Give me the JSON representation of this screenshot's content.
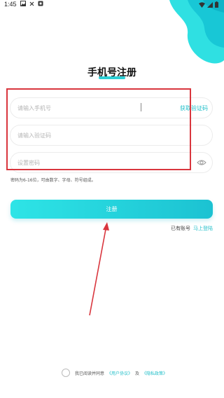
{
  "status_bar": {
    "time": "1:45"
  },
  "page": {
    "title": "手机号注册"
  },
  "form": {
    "phone_placeholder": "请输入手机号",
    "get_code_label": "获取验证码",
    "code_placeholder": "请输入验证码",
    "password_placeholder": "设置密码",
    "password_hint": "密码为6-16位，可由数字、字母、符号组成。",
    "submit_label": "注册"
  },
  "login": {
    "prompt": "已有账号",
    "link_label": "马上登陆"
  },
  "agreement": {
    "prefix": "我已阅读并同意",
    "user_agreement": "《用户协议》",
    "conjunction": "及",
    "privacy_policy": "《隐私政策》"
  },
  "colors": {
    "accent": "#21bfc9",
    "highlight_box": "#d9363e"
  }
}
